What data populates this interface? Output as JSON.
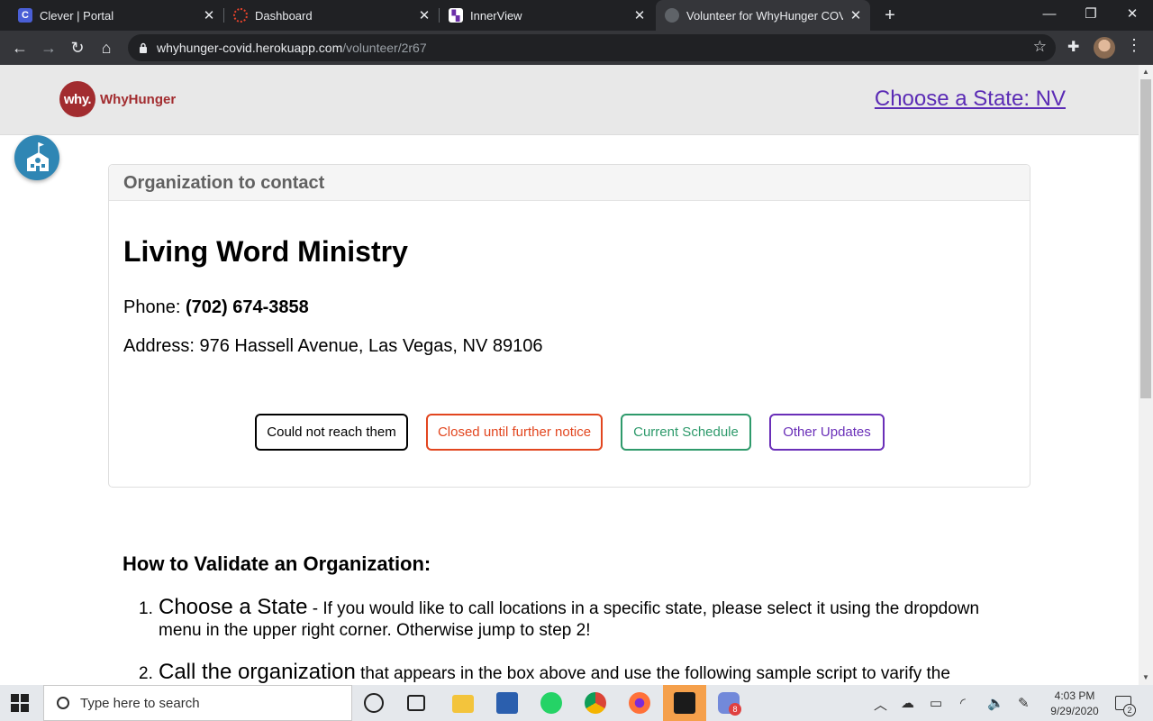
{
  "browser": {
    "tabs": [
      {
        "title": "Clever | Portal",
        "icon": "clever-icon",
        "color": "#4a5fd6",
        "active": false
      },
      {
        "title": "Dashboard",
        "icon": "dashboard-icon",
        "color": "#e8432c",
        "active": false
      },
      {
        "title": "InnerView",
        "icon": "innerview-icon",
        "color": "#6b2fa8",
        "active": false
      },
      {
        "title": "Volunteer for WhyHunger COVID",
        "icon": "globe-icon",
        "color": "#9aa0a6",
        "active": true
      }
    ],
    "address": {
      "host": "whyhunger-covid.herokuapp.com",
      "path": "/volunteer/2r67"
    }
  },
  "site": {
    "logo_badge": "why.",
    "logo_text": "WhyHunger",
    "state_link": "Choose a State: NV"
  },
  "card": {
    "header": "Organization to contact",
    "org_name": "Living Word Ministry",
    "phone_label": "Phone:",
    "phone_value": "(702) 674-3858",
    "address": "Address: 976 Hassell Avenue, Las Vegas, NV 89106",
    "buttons": [
      {
        "label": "Could not reach them",
        "color": "#000000"
      },
      {
        "label": "Closed until further notice",
        "color": "#e2461f"
      },
      {
        "label": "Current Schedule",
        "color": "#2e9a6b"
      },
      {
        "label": "Other Updates",
        "color": "#6a2fb8"
      }
    ]
  },
  "howto": {
    "title": "How to Validate an Organization:",
    "steps": [
      {
        "num": "1.",
        "lead": "Choose a State",
        "text": " - If you would like to call locations in a specific state, please select it using the dropdown menu in the upper right corner. Otherwise jump to step 2!"
      },
      {
        "num": "2.",
        "lead": "Call the organization",
        "text": " that appears in the box above and use the following sample script to varify the"
      }
    ]
  },
  "taskbar": {
    "search_placeholder": "Type here to search",
    "time": "4:03 PM",
    "date": "9/29/2020",
    "notification_count": "2",
    "discord_badge": "8"
  }
}
